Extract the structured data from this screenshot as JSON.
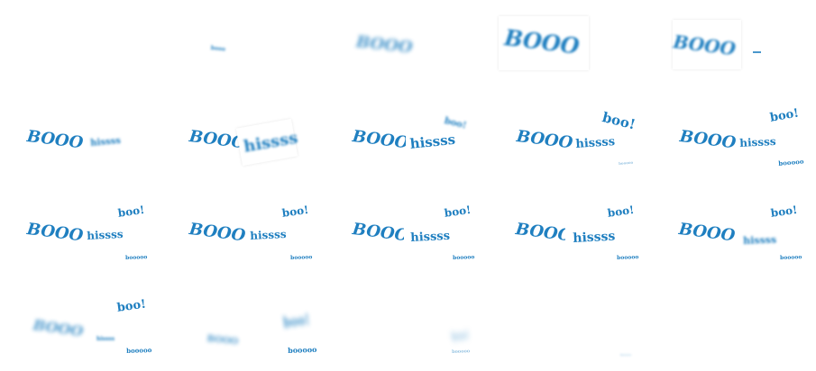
{
  "words": {
    "booo": "BOOO",
    "hissss": "hissss",
    "boo": "boo!",
    "booooo": "booooo",
    "tiny": "booo"
  },
  "colors": {
    "text": "#1f7fc0",
    "background": "#ffffff"
  }
}
